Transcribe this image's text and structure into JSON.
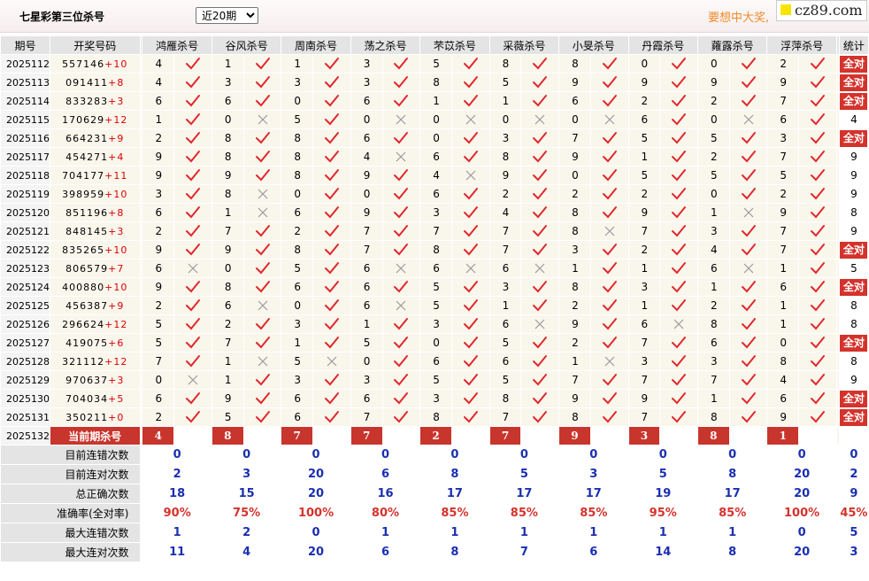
{
  "header": {
    "title": "七星彩第三位杀号",
    "period_select": {
      "selected": "近20期",
      "options": [
        "近20期"
      ]
    },
    "slogan": "要想中大奖,",
    "logo_text": "cz89.com"
  },
  "columns": {
    "period": "期号",
    "numbers": "开奖号码",
    "predictors": [
      "鸿雁杀号",
      "谷风杀号",
      "周南杀号",
      "荡之杀号",
      "芣苡杀号",
      "采薇杀号",
      "小旻杀号",
      "丹霞杀号",
      "蕹露杀号",
      "浮萍杀号"
    ],
    "stats": "统计"
  },
  "rows": [
    {
      "period": "2025112",
      "digits": "557146",
      "plus": "+10",
      "vals": [
        4,
        1,
        1,
        3,
        5,
        8,
        8,
        0,
        0,
        2
      ],
      "marks": "OOOOOOOOOO",
      "stat": "全对"
    },
    {
      "period": "2025113",
      "digits": "091411",
      "plus": "+8",
      "vals": [
        4,
        3,
        3,
        3,
        8,
        5,
        9,
        9,
        9,
        9
      ],
      "marks": "OOOOOOOOOO",
      "stat": "全对"
    },
    {
      "period": "2025114",
      "digits": "833283",
      "plus": "+3",
      "vals": [
        6,
        6,
        0,
        6,
        1,
        1,
        6,
        2,
        2,
        7
      ],
      "marks": "OOOOOOOOOO",
      "stat": "全对"
    },
    {
      "period": "2025115",
      "digits": "170629",
      "plus": "+12",
      "vals": [
        1,
        0,
        5,
        0,
        0,
        0,
        0,
        6,
        0,
        6
      ],
      "marks": "OXOXXXXOXO",
      "stat": "4"
    },
    {
      "period": "2025116",
      "digits": "664231",
      "plus": "+9",
      "vals": [
        2,
        8,
        8,
        6,
        0,
        3,
        7,
        5,
        5,
        3
      ],
      "marks": "OOOOOOOOOO",
      "stat": "全对"
    },
    {
      "period": "2025117",
      "digits": "454271",
      "plus": "+4",
      "vals": [
        9,
        8,
        8,
        4,
        6,
        8,
        9,
        1,
        2,
        7
      ],
      "marks": "OOOXOOOOOO",
      "stat": "9"
    },
    {
      "period": "2025118",
      "digits": "704177",
      "plus": "+11",
      "vals": [
        9,
        9,
        8,
        9,
        4,
        9,
        0,
        5,
        5,
        5
      ],
      "marks": "OOOOXOOOOO",
      "stat": "9"
    },
    {
      "period": "2025119",
      "digits": "398959",
      "plus": "+10",
      "vals": [
        3,
        8,
        0,
        0,
        6,
        2,
        2,
        2,
        0,
        2
      ],
      "marks": "OXOOOOOOOO",
      "stat": "9"
    },
    {
      "period": "2025120",
      "digits": "851196",
      "plus": "+8",
      "vals": [
        6,
        1,
        6,
        9,
        3,
        4,
        8,
        9,
        1,
        9
      ],
      "marks": "OXOOOOOOXO",
      "stat": "8"
    },
    {
      "period": "2025121",
      "digits": "848145",
      "plus": "+3",
      "vals": [
        2,
        7,
        2,
        7,
        7,
        7,
        8,
        7,
        3,
        7
      ],
      "marks": "OOOOOOXOOO",
      "stat": "9"
    },
    {
      "period": "2025122",
      "digits": "835265",
      "plus": "+10",
      "vals": [
        9,
        9,
        8,
        7,
        8,
        7,
        3,
        2,
        4,
        7
      ],
      "marks": "OOOOOOOOOO",
      "stat": "全对"
    },
    {
      "period": "2025123",
      "digits": "806579",
      "plus": "+7",
      "vals": [
        6,
        0,
        5,
        6,
        6,
        6,
        1,
        1,
        6,
        1
      ],
      "marks": "XOOXXXOOXO",
      "stat": "5"
    },
    {
      "period": "2025124",
      "digits": "400880",
      "plus": "+10",
      "vals": [
        9,
        8,
        6,
        6,
        5,
        3,
        8,
        3,
        1,
        6
      ],
      "marks": "OOOOOOOOOO",
      "stat": "全对"
    },
    {
      "period": "2025125",
      "digits": "456387",
      "plus": "+9",
      "vals": [
        2,
        6,
        0,
        6,
        5,
        1,
        2,
        1,
        2,
        1
      ],
      "marks": "OXOXOOOOOO",
      "stat": "8"
    },
    {
      "period": "2025126",
      "digits": "296624",
      "plus": "+12",
      "vals": [
        5,
        2,
        3,
        1,
        3,
        6,
        9,
        6,
        8,
        1
      ],
      "marks": "OOOOOXOXOO",
      "stat": "8"
    },
    {
      "period": "2025127",
      "digits": "419075",
      "plus": "+6",
      "vals": [
        5,
        7,
        1,
        5,
        0,
        5,
        2,
        7,
        6,
        0
      ],
      "marks": "OOOOOOOOOO",
      "stat": "全对"
    },
    {
      "period": "2025128",
      "digits": "321112",
      "plus": "+12",
      "vals": [
        7,
        1,
        5,
        0,
        6,
        6,
        1,
        3,
        3,
        8
      ],
      "marks": "OXXOOOXOOO",
      "stat": "8"
    },
    {
      "period": "2025129",
      "digits": "970637",
      "plus": "+3",
      "vals": [
        0,
        1,
        3,
        3,
        5,
        5,
        7,
        7,
        7,
        4
      ],
      "marks": "XOOOOOOOOO",
      "stat": "9"
    },
    {
      "period": "2025130",
      "digits": "704034",
      "plus": "+5",
      "vals": [
        6,
        9,
        6,
        6,
        3,
        8,
        9,
        9,
        1,
        6
      ],
      "marks": "OOOOOOOOOO",
      "stat": "全对"
    },
    {
      "period": "2025131",
      "digits": "350211",
      "plus": "+0",
      "vals": [
        2,
        5,
        6,
        7,
        8,
        7,
        8,
        7,
        8,
        9
      ],
      "marks": "OOOOOOOOOO",
      "stat": "全对"
    }
  ],
  "current": {
    "period": "2025132",
    "label": "当前期杀号",
    "vals": [
      "4",
      "8",
      "7",
      "7",
      "2",
      "7",
      "9",
      "3",
      "8",
      "1"
    ]
  },
  "stats": [
    {
      "label": "目前连错次数",
      "vals": [
        "0",
        "0",
        "0",
        "0",
        "0",
        "0",
        "0",
        "0",
        "0",
        "0",
        "0"
      ],
      "red": false
    },
    {
      "label": "目前连对次数",
      "vals": [
        "2",
        "3",
        "20",
        "6",
        "8",
        "5",
        "3",
        "5",
        "8",
        "20",
        "2"
      ],
      "red": false
    },
    {
      "label": "总正确次数",
      "vals": [
        "18",
        "15",
        "20",
        "16",
        "17",
        "17",
        "17",
        "19",
        "17",
        "20",
        "9"
      ],
      "red": false
    },
    {
      "label": "准确率(全对率)",
      "vals": [
        "90%",
        "75%",
        "100%",
        "80%",
        "85%",
        "85%",
        "85%",
        "95%",
        "85%",
        "100%",
        "45%"
      ],
      "red": true
    },
    {
      "label": "最大连错次数",
      "vals": [
        "1",
        "2",
        "0",
        "1",
        "1",
        "1",
        "1",
        "1",
        "1",
        "0",
        "5"
      ],
      "red": false
    },
    {
      "label": "最大连对次数",
      "vals": [
        "11",
        "4",
        "20",
        "6",
        "8",
        "7",
        "6",
        "14",
        "8",
        "20",
        "3"
      ],
      "red": false
    }
  ],
  "icons": {
    "correct": "check-icon",
    "wrong": "cross-icon"
  },
  "colors": {
    "check": "#e0282c",
    "cross": "#9a9a9a",
    "badge": "#d4332c",
    "stat_blue": "#1b2fb0",
    "slogan": "#f08c2a"
  }
}
